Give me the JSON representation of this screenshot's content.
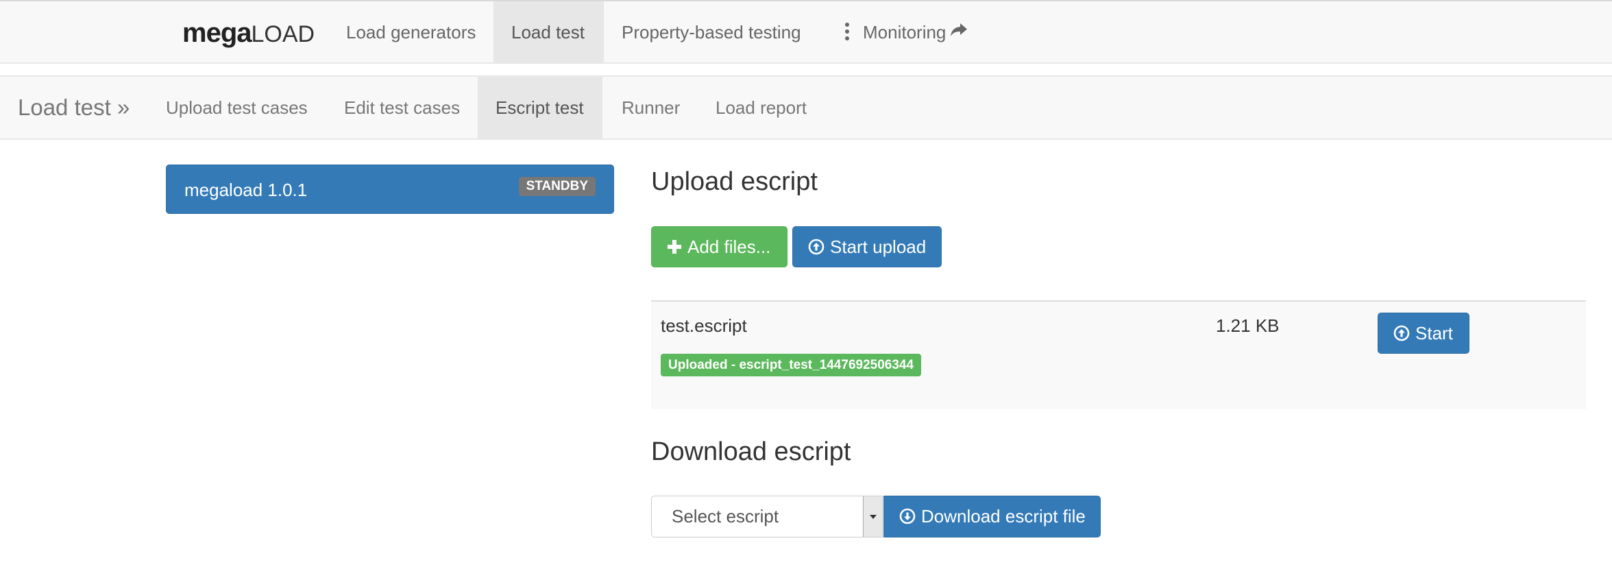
{
  "top_nav": {
    "brand_bold": "mega",
    "brand_light": "LOAD",
    "items": [
      {
        "label": "Load generators"
      },
      {
        "label": "Load test"
      },
      {
        "label": "Property-based testing"
      },
      {
        "label": "Monitoring"
      }
    ],
    "active_item": "Load test"
  },
  "sub_nav": {
    "brand": "Load test »",
    "items": [
      {
        "label": "Upload test cases"
      },
      {
        "label": "Edit test cases"
      },
      {
        "label": "Escript test"
      },
      {
        "label": "Runner"
      },
      {
        "label": "Load report"
      }
    ],
    "active_item": "Escript test"
  },
  "version_panel": {
    "title": "megaload 1.0.1",
    "badge": "STANDBY"
  },
  "upload_section": {
    "heading": "Upload escript",
    "add_files_label": "Add files...",
    "start_upload_label": "Start upload",
    "files": [
      {
        "name": "test.escript",
        "size": "1.21 KB",
        "status": "Uploaded - escript_test_1447692506344",
        "start_label": "Start"
      }
    ]
  },
  "download_section": {
    "heading": "Download escript",
    "select_value": "Select escript",
    "download_label": "Download escript file"
  },
  "colors": {
    "primary": "#337ab7",
    "success": "#5cb85c",
    "badge_default": "#777777",
    "navbar_bg": "#f8f8f8",
    "nav_active_bg": "#e7e7e7"
  },
  "icons": {
    "add_files": "plus-icon",
    "start_upload": "circle-arrow-up-icon",
    "start": "circle-arrow-up-icon",
    "download": "circle-arrow-down-icon",
    "monitoring_menu": "kebab-icon",
    "monitoring_external": "share-arrow-icon"
  }
}
